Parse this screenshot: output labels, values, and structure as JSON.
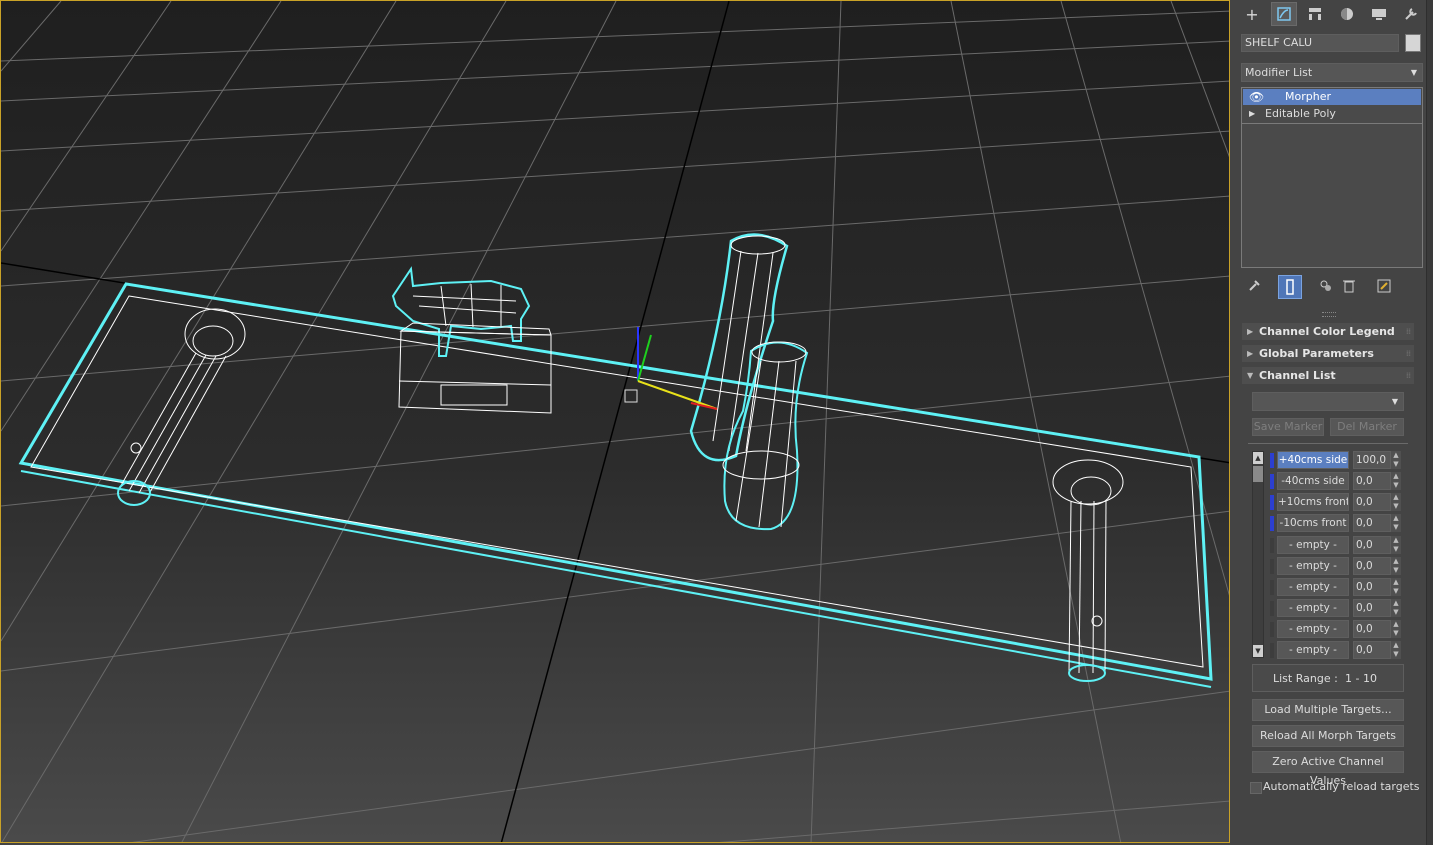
{
  "viewport": {
    "label": "3D wireframe viewport",
    "selection_color": "#5ef1f5",
    "grid_color": "#6a6a6a",
    "active_border_color": "#c9a227"
  },
  "command_panel": {
    "tabs": [
      "create-tab",
      "modify-tab",
      "hierarchy-tab",
      "motion-tab",
      "display-tab",
      "utilities-tab"
    ],
    "object_name": "SHELF CALU",
    "modifier_list_label": "Modifier List",
    "stack": [
      {
        "label": "Morpher",
        "selected": true
      },
      {
        "label": "Editable Poly",
        "selected": false
      }
    ],
    "rollouts": {
      "legend": "Channel Color Legend",
      "global": "Global Parameters",
      "channel_list": "Channel List"
    },
    "channel_list": {
      "dropdown_value": "",
      "save_marker": "Save Marker",
      "del_marker": "Del Marker",
      "channels": [
        {
          "name": "+40cms side",
          "value": "100,0",
          "active": true,
          "selected": true
        },
        {
          "name": "-40cms side",
          "value": "0,0",
          "active": true,
          "selected": false
        },
        {
          "name": "+10cms front",
          "value": "0,0",
          "active": true,
          "selected": false
        },
        {
          "name": "-10cms front",
          "value": "0,0",
          "active": true,
          "selected": false
        },
        {
          "name": "- empty -",
          "value": "0,0",
          "active": false,
          "selected": false
        },
        {
          "name": "- empty -",
          "value": "0,0",
          "active": false,
          "selected": false
        },
        {
          "name": "- empty -",
          "value": "0,0",
          "active": false,
          "selected": false
        },
        {
          "name": "- empty -",
          "value": "0,0",
          "active": false,
          "selected": false
        },
        {
          "name": "- empty -",
          "value": "0,0",
          "active": false,
          "selected": false
        },
        {
          "name": "- empty -",
          "value": "0,0",
          "active": false,
          "selected": false
        }
      ],
      "list_range_label": "List Range :",
      "list_range_value": "1 - 10",
      "load_multiple": "Load Multiple Targets...",
      "reload_all": "Reload All Morph Targets",
      "zero_active": "Zero Active Channel Values",
      "auto_reload": "Automatically reload targets",
      "auto_reload_checked": false
    }
  }
}
